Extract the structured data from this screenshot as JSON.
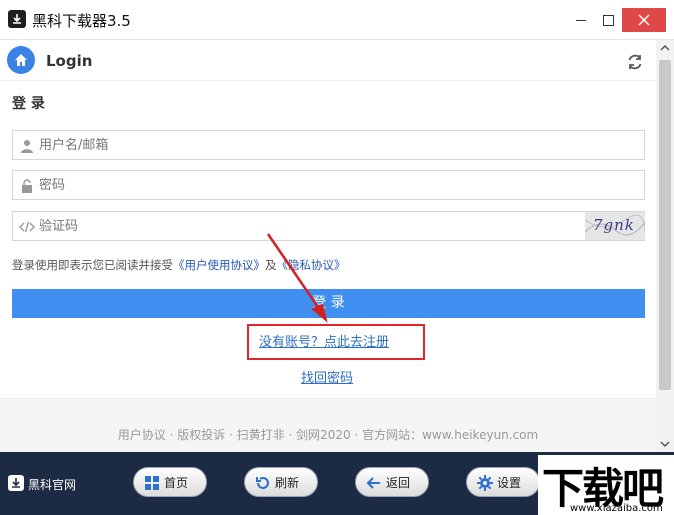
{
  "window": {
    "title": "黑科下载器3.5"
  },
  "header": {
    "title": "Login"
  },
  "form": {
    "section_title": "登 录",
    "username_placeholder": "用户名/邮箱",
    "password_placeholder": "密码",
    "captcha_placeholder": "验证码",
    "captcha_text": "7gnk",
    "agreement_prefix": "登录使用即表示您已阅读并接受",
    "user_agreement": "《用户使用协议》",
    "agreement_and": "及",
    "privacy_policy": "《隐私协议》",
    "login_button": "登 录",
    "register_link": "没有账号？点此去注册",
    "forgot_link": "找回密码"
  },
  "footer": {
    "text": "用户协议 · 版权投诉 · 扫黄打非 · 剑网2020 · 官方网站：www.heikeyun.com"
  },
  "bottombar": {
    "brand": "黑科官网",
    "buttons": [
      {
        "label": "首页",
        "icon": "grid-icon"
      },
      {
        "label": "刷新",
        "icon": "refresh-icon"
      },
      {
        "label": "返回",
        "icon": "arrow-left-icon"
      },
      {
        "label": "设置",
        "icon": "gear-icon"
      }
    ]
  },
  "watermark": {
    "big": "下载吧",
    "small": "www.xiazaiba.com"
  },
  "colors": {
    "accent": "#3f8ef0",
    "highlight": "#e0262a",
    "bottom_bar": "#1d2a43",
    "link": "#2f6fc4"
  }
}
